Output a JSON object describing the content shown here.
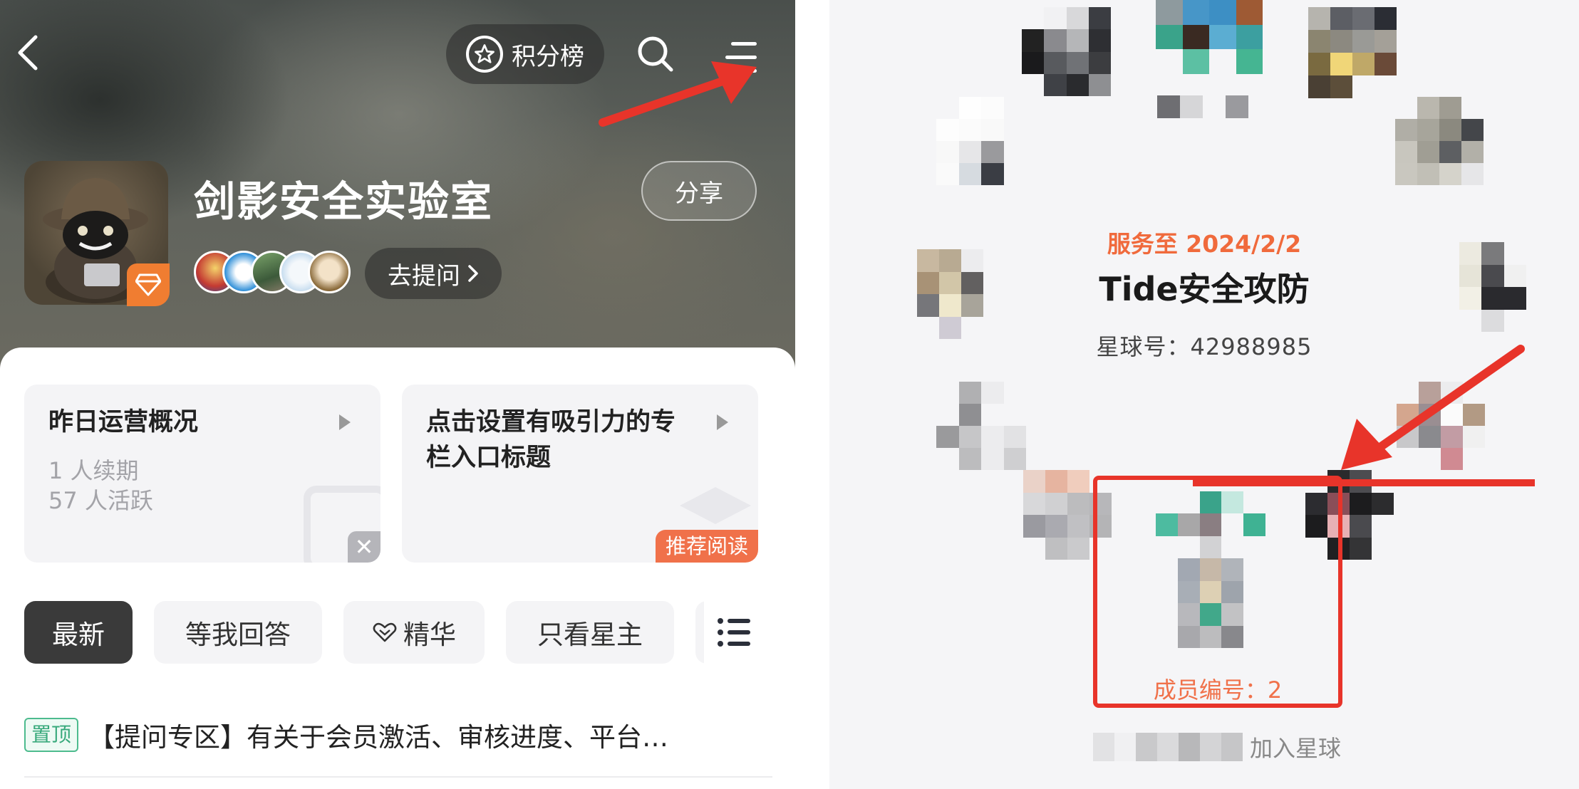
{
  "left_panel": {
    "header": {
      "rank_label": "积分榜"
    },
    "group": {
      "title": "剑影安全实验室",
      "share_label": "分享",
      "ask_label": "去提问"
    },
    "cards": {
      "operations": {
        "title": "昨日运营概况",
        "stat_renew": "1 人续期",
        "stat_active": "57 人活跃"
      },
      "column": {
        "title_line1": "点击设置有吸引力的专",
        "title_line2": "栏入口标题",
        "tag": "推荐阅读"
      }
    },
    "tabs": [
      {
        "label": "最新",
        "active": true
      },
      {
        "label": "等我回答",
        "active": false
      },
      {
        "label": "精华",
        "active": false
      },
      {
        "label": "只看星主",
        "active": false
      }
    ],
    "pinned_post": {
      "badge": "置顶",
      "text": "【提问专区】有关于会员激活、审核进度、平台…"
    },
    "colors": {
      "accent_orange": "#f07d31",
      "tag_orange": "#f0714a",
      "pin_green": "#4dbb8e",
      "arrow_red": "#e8342a"
    }
  },
  "right_panel": {
    "service_until": "服务至 2024/2/2",
    "planet_name": "Tide安全攻防",
    "planet_number": "星球号：42988985",
    "member_number": "成员编号：2",
    "join_label": "加入星球",
    "colors": {
      "service_orange": "#f06a3c",
      "highlight_red": "#e8342a"
    }
  }
}
